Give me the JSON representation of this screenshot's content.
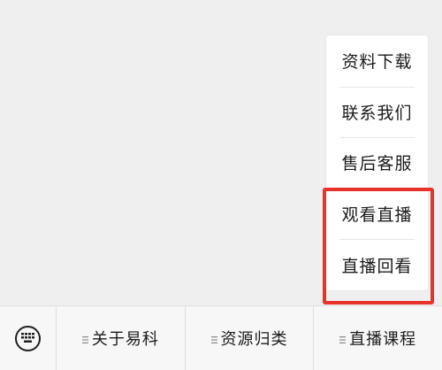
{
  "popup_menu": {
    "items": [
      {
        "label": "资料下载"
      },
      {
        "label": "联系我们"
      },
      {
        "label": "售后客服"
      },
      {
        "label": "观看直播"
      },
      {
        "label": "直播回看"
      }
    ]
  },
  "bottom_bar": {
    "keyboard_icon": "keyboard-icon",
    "menu_icon": "menu-lines-icon",
    "tabs": [
      {
        "label": "关于易科"
      },
      {
        "label": "资源归类"
      },
      {
        "label": "直播课程"
      }
    ]
  },
  "colors": {
    "highlight": "#e8322c",
    "background": "#efeff0",
    "bar_background": "#f7f7f7"
  }
}
